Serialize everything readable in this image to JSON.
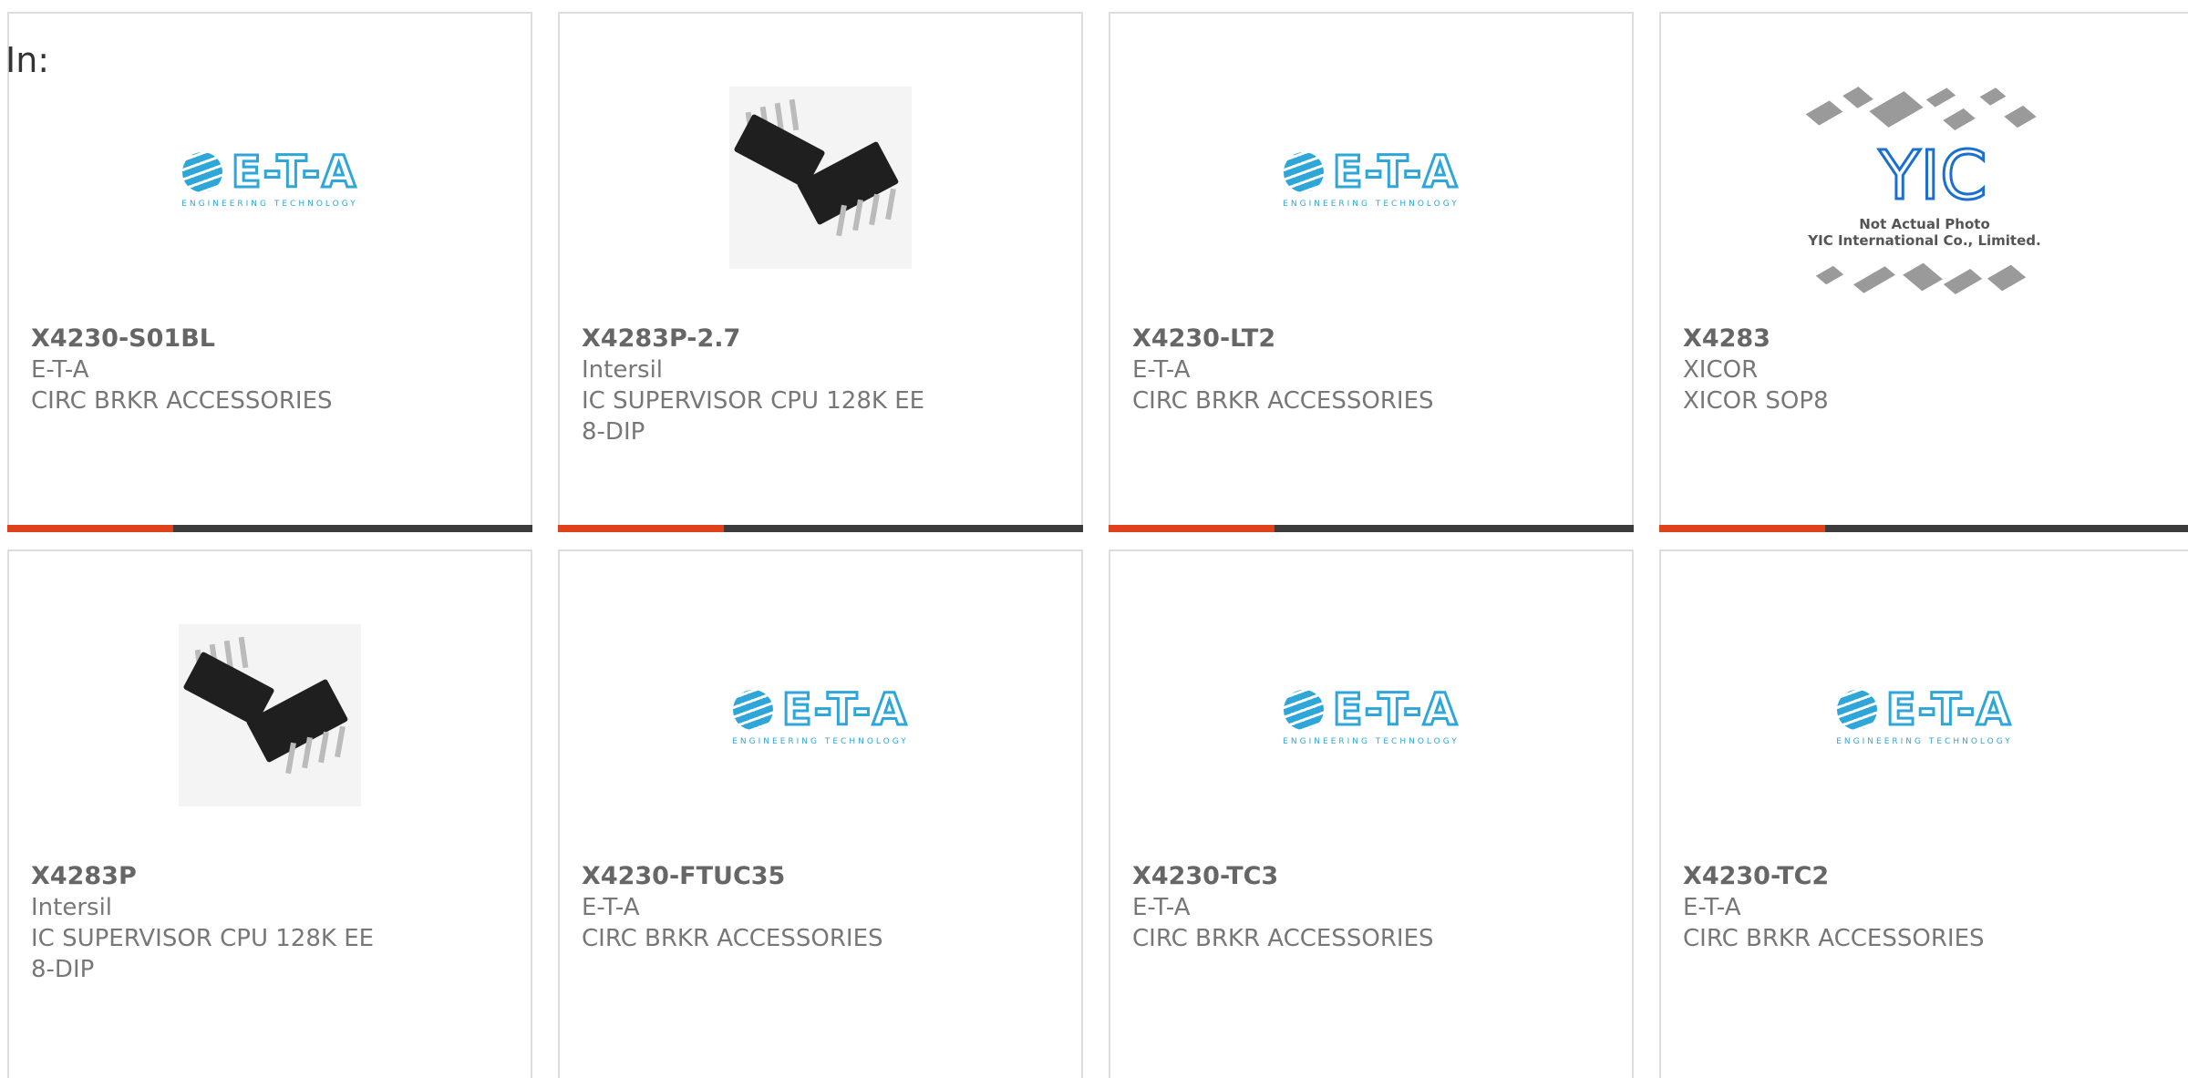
{
  "page": {
    "in_label": "In:"
  },
  "eta_logo": {
    "letters": "E-T-A",
    "sub": "ENGINEERING TECHNOLOGY"
  },
  "yic_photo": {
    "logo": "YIC",
    "line1": "Not Actual Photo",
    "line2": "YIC International Co., Limited."
  },
  "colors": {
    "accent": "#e0401a",
    "bar": "#3c3c3c",
    "border": "#dddddd"
  },
  "products": [
    {
      "part": "X4230-S01BL",
      "maker": "E-T-A",
      "desc": "CIRC BRKR ACCESSORIES",
      "image": "eta-logo"
    },
    {
      "part": "X4283P-2.7",
      "maker": "Intersil",
      "desc": "IC SUPERVISOR CPU 128K EE 8-DIP",
      "image": "dip-chip-photo"
    },
    {
      "part": "X4230-LT2",
      "maker": "E-T-A",
      "desc": "CIRC BRKR ACCESSORIES",
      "image": "eta-logo"
    },
    {
      "part": "X4283",
      "maker": "XICOR",
      "desc": "XICOR SOP8",
      "image": "yic-placeholder"
    },
    {
      "part": "X4283P",
      "maker": "Intersil",
      "desc": "IC SUPERVISOR CPU 128K EE 8-DIP",
      "image": "dip-chip-photo"
    },
    {
      "part": "X4230-FTUC35",
      "maker": "E-T-A",
      "desc": "CIRC BRKR ACCESSORIES",
      "image": "eta-logo"
    },
    {
      "part": "X4230-TC3",
      "maker": "E-T-A",
      "desc": "CIRC BRKR ACCESSORIES",
      "image": "eta-logo"
    },
    {
      "part": "X4230-TC2",
      "maker": "E-T-A",
      "desc": "CIRC BRKR ACCESSORIES",
      "image": "eta-logo"
    }
  ]
}
